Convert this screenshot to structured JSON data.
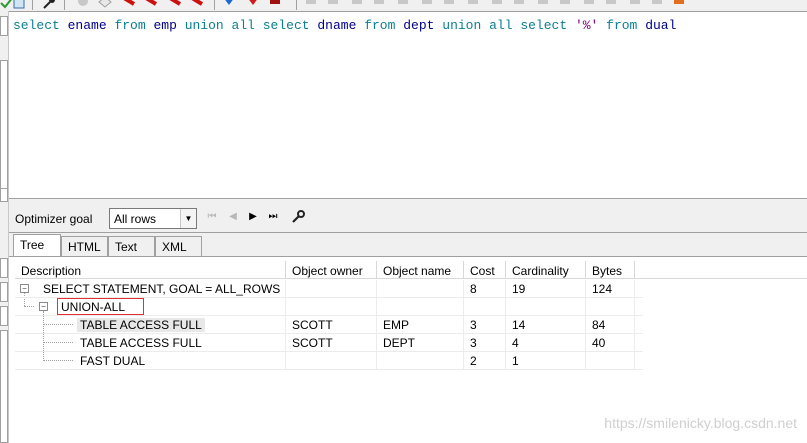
{
  "toolbar": {
    "icons": [
      "check-icon",
      "db-icon",
      "wrench-icon",
      "record-icon",
      "erase-icon",
      "red-tool-icon",
      "red-tool-icon",
      "red-tool-icon",
      "red-tool-icon",
      "arrow-down-blue-icon",
      "arrow-red-icon",
      "stop-icon",
      "grey-icon",
      "orange-icon"
    ]
  },
  "editor": {
    "sql_tokens": [
      {
        "t": "select",
        "c": "kw"
      },
      {
        "t": " "
      },
      {
        "t": "ename",
        "c": "id"
      },
      {
        "t": " "
      },
      {
        "t": "from",
        "c": "kw"
      },
      {
        "t": " "
      },
      {
        "t": "emp",
        "c": "id"
      },
      {
        "t": " "
      },
      {
        "t": "union",
        "c": "kw"
      },
      {
        "t": " "
      },
      {
        "t": "all",
        "c": "kw"
      },
      {
        "t": " "
      },
      {
        "t": "select",
        "c": "kw"
      },
      {
        "t": " "
      },
      {
        "t": "dname",
        "c": "id"
      },
      {
        "t": " "
      },
      {
        "t": "from",
        "c": "kw"
      },
      {
        "t": " "
      },
      {
        "t": "dept",
        "c": "id"
      },
      {
        "t": " "
      },
      {
        "t": "union",
        "c": "kw"
      },
      {
        "t": " "
      },
      {
        "t": "all",
        "c": "kw"
      },
      {
        "t": " "
      },
      {
        "t": "select",
        "c": "kw"
      },
      {
        "t": " "
      },
      {
        "t": "'%'",
        "c": "str"
      },
      {
        "t": " "
      },
      {
        "t": "from",
        "c": "kw"
      },
      {
        "t": " "
      },
      {
        "t": "dual",
        "c": "id"
      }
    ]
  },
  "optimizer": {
    "label": "Optimizer goal",
    "value": "All rows"
  },
  "tabs": [
    {
      "label": "Tree",
      "active": true
    },
    {
      "label": "HTML",
      "active": false
    },
    {
      "label": "Text",
      "active": false
    },
    {
      "label": "XML",
      "active": false
    }
  ],
  "grid": {
    "columns": [
      "Description",
      "Object owner",
      "Object name",
      "Cost",
      "Cardinality",
      "Bytes"
    ],
    "rows": [
      {
        "description": "SELECT STATEMENT, GOAL = ALL_ROWS",
        "owner": "",
        "name": "",
        "cost": "8",
        "cardinality": "19",
        "bytes": "124"
      },
      {
        "description": "UNION-ALL",
        "owner": "",
        "name": "",
        "cost": "",
        "cardinality": "",
        "bytes": ""
      },
      {
        "description": "TABLE ACCESS FULL",
        "owner": "SCOTT",
        "name": "EMP",
        "cost": "3",
        "cardinality": "14",
        "bytes": "84"
      },
      {
        "description": "TABLE ACCESS FULL",
        "owner": "SCOTT",
        "name": "DEPT",
        "cost": "3",
        "cardinality": "4",
        "bytes": "40"
      },
      {
        "description": "FAST DUAL",
        "owner": "",
        "name": "",
        "cost": "2",
        "cardinality": "1",
        "bytes": ""
      }
    ]
  },
  "watermark": "https://smilenicky.blog.csdn.net"
}
